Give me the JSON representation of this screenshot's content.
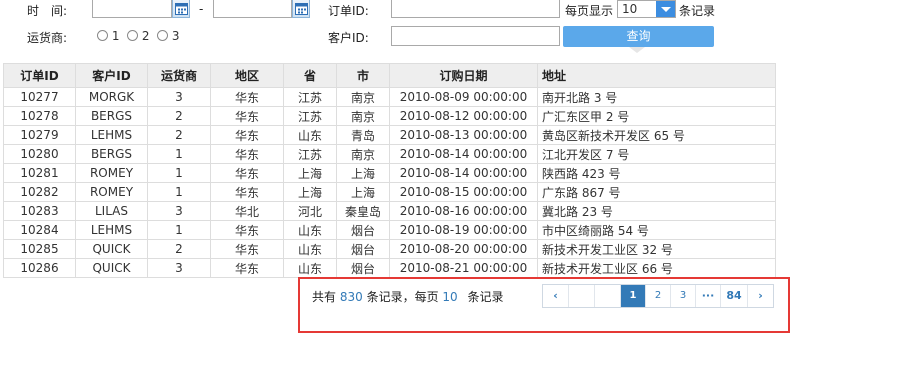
{
  "filters": {
    "time_label": "时　间:",
    "date_separator": "-",
    "order_id_label": "订单ID:",
    "page_size_label": "每页显示",
    "page_size_value": "10",
    "page_size_unit": "条记录",
    "shipper_label": "运货商:",
    "shipper_options": [
      "1",
      "2",
      "3"
    ],
    "customer_id_label": "客户ID:",
    "query_button": "查询"
  },
  "table": {
    "headers": [
      "订单ID",
      "客户ID",
      "运货商",
      "地区",
      "省",
      "市",
      "订购日期",
      "地址"
    ],
    "rows": [
      [
        "10277",
        "MORGK",
        "3",
        "华东",
        "江苏",
        "南京",
        "2010-08-09 00:00:00",
        "南开北路 3 号"
      ],
      [
        "10278",
        "BERGS",
        "2",
        "华东",
        "江苏",
        "南京",
        "2010-08-12 00:00:00",
        "广汇东区甲 2 号"
      ],
      [
        "10279",
        "LEHMS",
        "2",
        "华东",
        "山东",
        "青岛",
        "2010-08-13 00:00:00",
        "黄岛区新技术开发区 65 号"
      ],
      [
        "10280",
        "BERGS",
        "1",
        "华东",
        "江苏",
        "南京",
        "2010-08-14 00:00:00",
        "江北开发区 7 号"
      ],
      [
        "10281",
        "ROMEY",
        "1",
        "华东",
        "上海",
        "上海",
        "2010-08-14 00:00:00",
        "陕西路 423 号"
      ],
      [
        "10282",
        "ROMEY",
        "1",
        "华东",
        "上海",
        "上海",
        "2010-08-15 00:00:00",
        "广东路 867 号"
      ],
      [
        "10283",
        "LILAS",
        "3",
        "华北",
        "河北",
        "秦皇岛",
        "2010-08-16 00:00:00",
        "冀北路 23 号"
      ],
      [
        "10284",
        "LEHMS",
        "1",
        "华东",
        "山东",
        "烟台",
        "2010-08-19 00:00:00",
        "市中区绮丽路 54 号"
      ],
      [
        "10285",
        "QUICK",
        "2",
        "华东",
        "山东",
        "烟台",
        "2010-08-20 00:00:00",
        "新技术开发工业区 32 号"
      ],
      [
        "10286",
        "QUICK",
        "3",
        "华东",
        "山东",
        "烟台",
        "2010-08-21 00:00:00",
        "新技术开发工业区 66 号"
      ]
    ]
  },
  "pagination": {
    "prefix": "共有",
    "total": "830",
    "middle": "条记录，每页",
    "per_page": "10",
    "suffix": "条记录",
    "prev": "‹",
    "pages": [
      "1",
      "2",
      "3"
    ],
    "ellipsis": "···",
    "last_page": "84",
    "next": "›"
  }
}
